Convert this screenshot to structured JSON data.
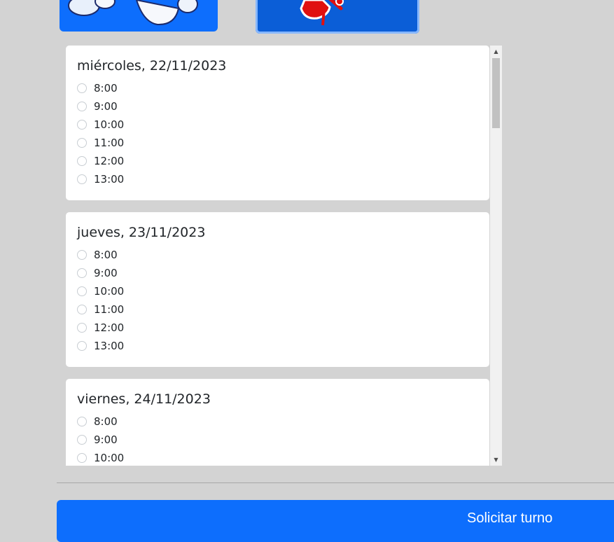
{
  "days": [
    {
      "label": "miércoles, 22/11/2023",
      "slots": [
        "8:00",
        "9:00",
        "10:00",
        "11:00",
        "12:00",
        "13:00"
      ]
    },
    {
      "label": "jueves, 23/11/2023",
      "slots": [
        "8:00",
        "9:00",
        "10:00",
        "11:00",
        "12:00",
        "13:00"
      ]
    },
    {
      "label": "viernes, 24/11/2023",
      "slots": [
        "8:00",
        "9:00",
        "10:00"
      ]
    }
  ],
  "submit_label": "Solicitar turno",
  "colors": {
    "primary": "#0d6efd",
    "primary_active": "#0b5ed7",
    "background": "#d3d3d3"
  },
  "icons": {
    "left_card": "snowman-character-image",
    "right_card": "red-character-image"
  }
}
